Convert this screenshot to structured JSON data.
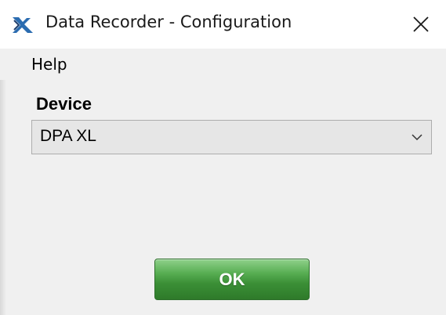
{
  "window": {
    "title": "Data Recorder - Configuration",
    "app_icon": "data-recorder-logo-icon",
    "close_icon": "close-icon"
  },
  "menu": {
    "items": [
      "Help"
    ]
  },
  "device": {
    "label": "Device",
    "selected": "DPA XL",
    "dropdown_icon": "chevron-down-icon"
  },
  "actions": {
    "ok_label": "OK"
  },
  "colors": {
    "ok_button": "#3f9a3a",
    "app_icon_blue": "#2b6cb0",
    "app_icon_dark": "#1f3f6e"
  }
}
